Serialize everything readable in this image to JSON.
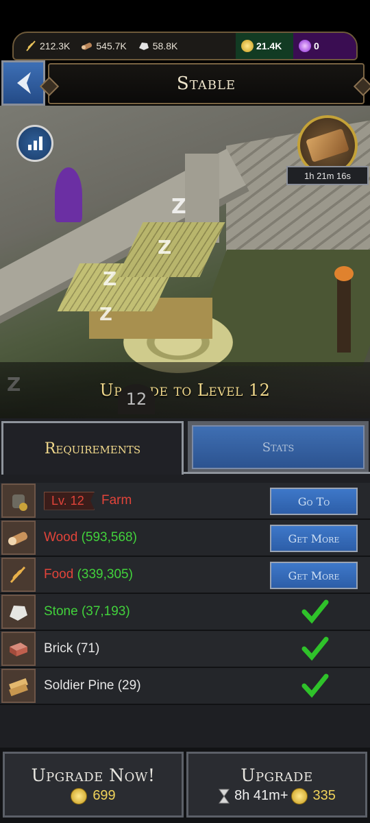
{
  "resources": {
    "food": "212.3K",
    "wood": "545.7K",
    "stone": "58.8K",
    "gold": "21.4K",
    "gems": "0"
  },
  "title": "Stable",
  "timer": "1h 21m 16s",
  "scene_level_badge": "12",
  "upgrade_banner": "Upgrade to Level 12",
  "tabs": {
    "requirements": "Requirements",
    "stats": "Stats"
  },
  "requirements": [
    {
      "icon": "farm-icon",
      "level": "Lv. 12",
      "name": "Farm",
      "action": "Go To"
    },
    {
      "icon": "wood-icon",
      "name": "Wood",
      "amount": "(593,568)",
      "action": "Get More"
    },
    {
      "icon": "food-icon",
      "name": "Food",
      "amount": "(339,305)",
      "action": "Get More"
    },
    {
      "icon": "stone-icon",
      "name": "Stone",
      "amount": "(37,193)",
      "met": true
    },
    {
      "icon": "brick-icon",
      "name": "Brick (71)",
      "met": true
    },
    {
      "icon": "soldier-pine-icon",
      "name": "Soldier Pine (29)",
      "met": true
    }
  ],
  "buttons": {
    "upgrade_now": "Upgrade Now!",
    "upgrade_now_cost": "699",
    "upgrade": "Upgrade",
    "upgrade_time": "8h 41m+",
    "upgrade_cost": "335"
  },
  "colors": {
    "unmet": "#e2443a",
    "met": "#42d23c",
    "accent_gold": "#f1d98c",
    "button_blue": "#3e78c9"
  }
}
